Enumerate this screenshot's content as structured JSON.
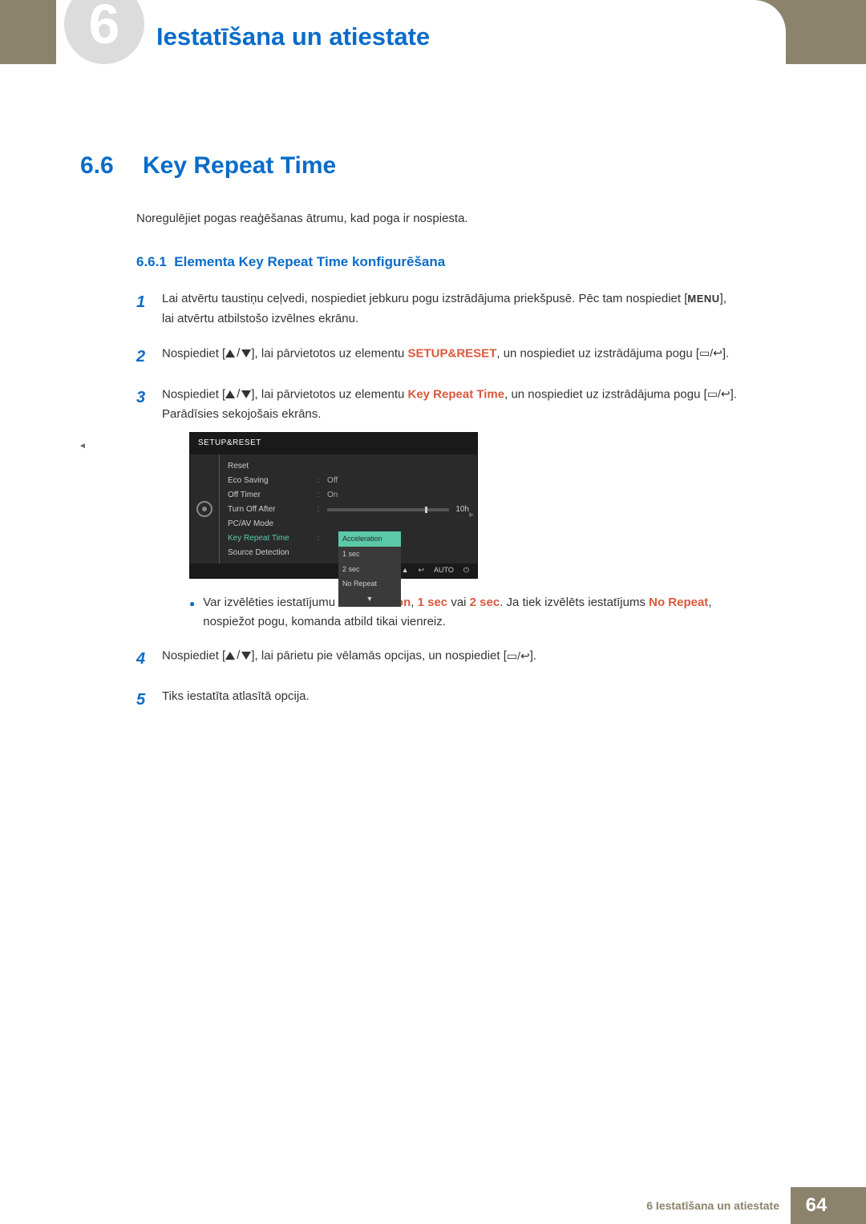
{
  "chapter": {
    "number": "6",
    "title": "Iestatīšana un atiestate"
  },
  "section": {
    "number": "6.6",
    "title": "Key Repeat Time"
  },
  "intro": "Noregulējiet pogas reaģēšanas ātrumu, kad poga ir nospiesta.",
  "subsection": {
    "number": "6.6.1",
    "title": "Elementa Key Repeat Time konfigurēšana"
  },
  "steps": {
    "s1": {
      "a": "Lai atvērtu taustiņu ceļvedi, nospiediet jebkuru pogu izstrādājuma priekšpusē. Pēc tam nospiediet [",
      "menu": "MENU",
      "b": "], lai atvērtu atbilstošo izvēlnes ekrānu."
    },
    "s2": {
      "a": "Nospiediet [",
      "b": "], lai pārvietotos uz elementu ",
      "hl": "SETUP&RESET",
      "c": ", un nospiediet uz izstrādājuma pogu [",
      "d": "]."
    },
    "s3": {
      "a": "Nospiediet [",
      "b": "], lai pārvietotos uz elementu ",
      "hl": "Key Repeat Time",
      "c": ", un nospiediet uz izstrādājuma pogu [",
      "d": "]. Parādīsies sekojošais ekrāns."
    },
    "bullet": {
      "a": "Var izvēlēties iestatījumu ",
      "h1": "Acceleration",
      "comma1": ", ",
      "h2": "1 sec",
      "or": " vai ",
      "h3": "2 sec",
      "b": ". Ja tiek izvēlēts iestatījums ",
      "h4": "No Repeat",
      "c": ", nospiežot pogu, komanda atbild tikai vienreiz."
    },
    "s4": {
      "a": "Nospiediet [",
      "b": "], lai pārietu pie vēlamās opcijas, un nospiediet [",
      "c": "]."
    },
    "s5": "Tiks iestatīta atlasītā opcija."
  },
  "osd": {
    "title": "SETUP&RESET",
    "rows": {
      "reset": "Reset",
      "eco": "Eco Saving",
      "eco_v": "Off",
      "off": "Off Timer",
      "off_v": "On",
      "turn": "Turn Off After",
      "turn_v": "10h",
      "pcav": "PC/AV Mode",
      "keyrep": "Key Repeat Time",
      "source": "Source Detection"
    },
    "dropdown": {
      "o1": "Acceleration",
      "o2": "1 sec",
      "o3": "2 sec",
      "o4": "No Repeat"
    },
    "foot_auto": "AUTO"
  },
  "footer": {
    "label": "6 Iestatīšana un atiestate",
    "page": "64"
  }
}
